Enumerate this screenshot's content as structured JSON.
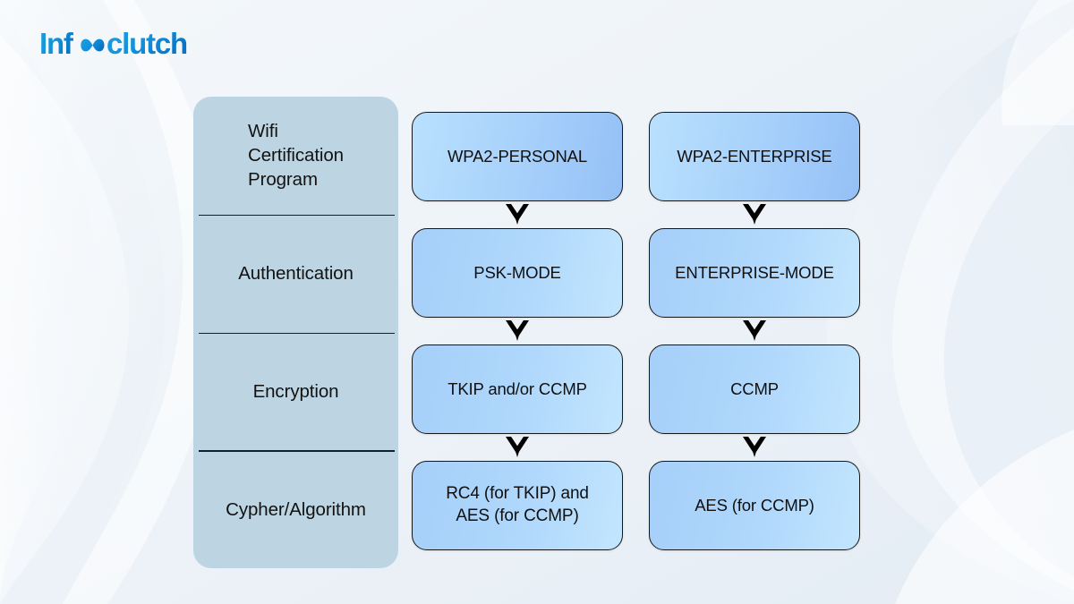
{
  "brand": {
    "name": "Infoclutch",
    "part_one": "Inf",
    "part_two": "clutch",
    "logo_icon": "infinity-icon",
    "color_light": "#1aa0e2",
    "color_dark": "#0b73c4"
  },
  "theme": {
    "page_background": "#eef3f8",
    "label_panel_background": "#bdd5e3",
    "divider_color": "#0c2230",
    "box_border_color": "#171717",
    "box_gradient_start": "#b9e0fd",
    "box_gradient_end": "#94c0f6",
    "text_color": "#101010"
  },
  "row_labels": [
    {
      "id": "wifi-certification-program",
      "text": "Wifi\nCertification\nProgram"
    },
    {
      "id": "authentication",
      "text": "Authentication"
    },
    {
      "id": "encryption",
      "text": "Encryption"
    },
    {
      "id": "cypher-algorithm",
      "text": "Cypher/Algorithm"
    }
  ],
  "columns": [
    {
      "id": "wpa2-personal",
      "boxes": [
        {
          "id": "wpa2-personal-box",
          "text": "WPA2-PERSONAL"
        },
        {
          "id": "psk-mode-box",
          "text": "PSK-MODE"
        },
        {
          "id": "tkip-ccmp-box",
          "text": "TKIP and/or CCMP"
        },
        {
          "id": "rc4-aes-box",
          "text": "RC4 (for TKIP) and\nAES (for CCMP)"
        }
      ]
    },
    {
      "id": "wpa2-enterprise",
      "boxes": [
        {
          "id": "wpa2-enterprise-box",
          "text": "WPA2-ENTERPRISE"
        },
        {
          "id": "enterprise-mode-box",
          "text": "ENTERPRISE-MODE"
        },
        {
          "id": "ccmp-box",
          "text": "CCMP"
        },
        {
          "id": "aes-ccmp-box",
          "text": "AES (for CCMP)"
        }
      ]
    }
  ],
  "arrows": {
    "icon": "chevron-down-arrow-icon",
    "color": "#000000",
    "count_per_column": 3
  }
}
